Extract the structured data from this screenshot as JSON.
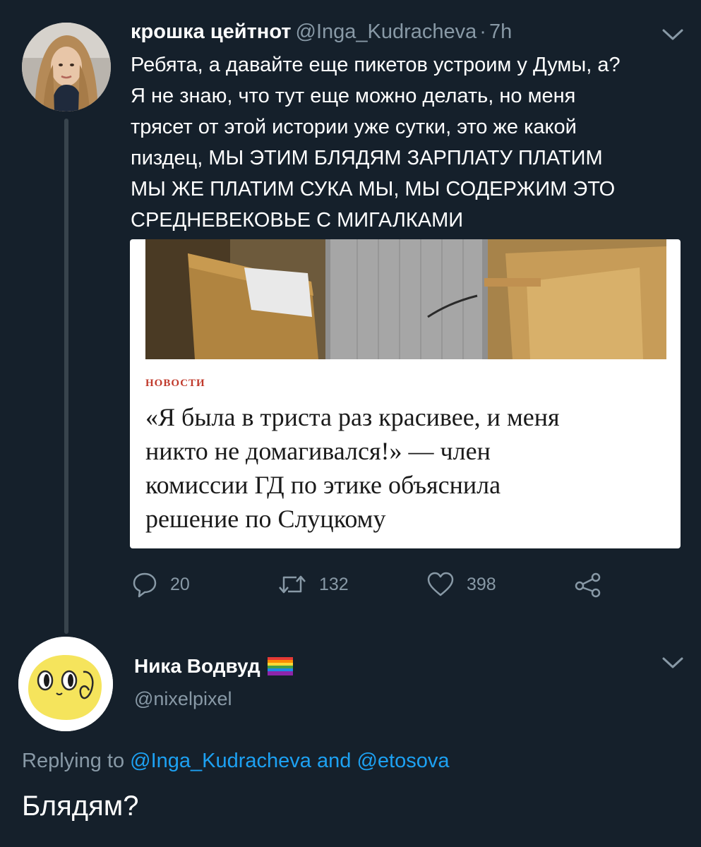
{
  "tweet": {
    "author_name": "крошка цейтнот",
    "author_handle": "@Inga_Kudracheva",
    "separator": "·",
    "time": "7h",
    "text_lines": [
      "Ребята, а давайте еще пикетов устроим у Думы, а?",
      "Я не знаю, что тут еще можно делать, но меня",
      "трясет от этой истории уже сутки, это же какой",
      "пиздец, МЫ ЭТИМ БЛЯДЯМ ЗАРПЛАТУ ПЛАТИМ",
      "МЫ ЖЕ ПЛАТИМ СУКА МЫ, МЫ СОДЕРЖИМ ЭТО",
      "СРЕДНЕВЕКОВЬЕ С МИГАЛКАМИ"
    ],
    "card": {
      "label": "НОВОСТИ",
      "title_lines": [
        "«Я была в триста раз красивее, и меня",
        "никто не домагивался!» — член",
        "комиссии ГД по этике объяснила",
        "решение по Слуцкому"
      ]
    },
    "actions": {
      "replies": "20",
      "retweets": "132",
      "likes": "398"
    }
  },
  "reply": {
    "author_name": "Ника Водвуд",
    "author_handle": "@nixelpixel",
    "replying_prefix": "Replying to",
    "mention_1": "@Inga_Kudracheva",
    "conjunction": "and",
    "mention_2": "@etosova",
    "text": "Блядям?"
  },
  "icons": {
    "reply": "speech-bubble-icon",
    "retweet": "retweet-icon",
    "like": "heart-icon",
    "share": "share-icon",
    "menu": "chevron-down-icon",
    "flag": "rainbow-flag-icon"
  },
  "colors": {
    "background": "#15202b",
    "secondary_text": "#8899a6",
    "link": "#1da1f2",
    "thread_line": "#38444d",
    "card_label": "#c0392b"
  }
}
